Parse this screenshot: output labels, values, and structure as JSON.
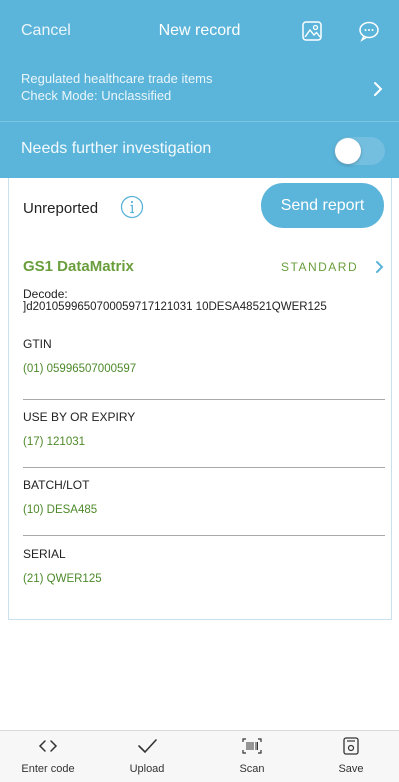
{
  "header": {
    "cancel_label": "Cancel",
    "title": "New record",
    "icons": [
      "image-icon",
      "chat-bubble-icon"
    ]
  },
  "mode": {
    "line1": "Regulated healthcare trade items",
    "line2": "Check Mode: Unclassified"
  },
  "investigation": {
    "label": "Needs further investigation",
    "toggle_on": false
  },
  "status": {
    "label": "Unreported",
    "send_button": "Send report"
  },
  "symbology": {
    "name": "GS1 DataMatrix",
    "standard": "STANDARD"
  },
  "decode": {
    "label": "Decode:",
    "value": "]d2010599650700059717121031 10DESA48521QWER125"
  },
  "fields": [
    {
      "label": "GTIN",
      "value": "(01) 05996507000597"
    },
    {
      "label": "USE BY OR EXPIRY",
      "value": "(17) 121031"
    },
    {
      "label": "BATCH/LOT",
      "value": "(10) DESA485"
    },
    {
      "label": "SERIAL",
      "value": "(21) QWER125"
    }
  ],
  "tabs": [
    {
      "label": "Enter code",
      "icon": "code-brackets-icon"
    },
    {
      "label": "Upload",
      "icon": "checkmark-icon"
    },
    {
      "label": "Scan",
      "icon": "barcode-scan-icon"
    },
    {
      "label": "Save",
      "icon": "save-icon"
    }
  ],
  "colors": {
    "header_bg": "#5bb4d9",
    "accent_green": "#6a9e3c",
    "value_green": "#4d8a2a"
  }
}
